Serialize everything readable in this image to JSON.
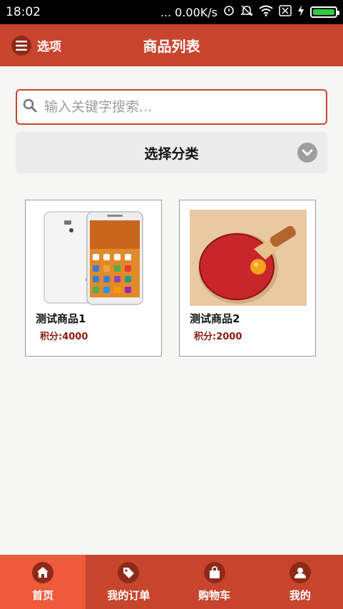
{
  "status_bar": {
    "time": "18:02",
    "network_speed": "... 0.00K/s",
    "battery_color": "#2ecc40"
  },
  "header": {
    "menu_label": "选项",
    "title": "商品列表"
  },
  "search": {
    "placeholder": "输入关键字搜索..."
  },
  "category": {
    "label": "选择分类"
  },
  "products": [
    {
      "name": "测试商品1",
      "points": "积分:4000",
      "image": "phone"
    },
    {
      "name": "测试商品2",
      "points": "积分:2000",
      "image": "ping-pong-paddle"
    }
  ],
  "tabbar": {
    "items": [
      {
        "label": "首页",
        "icon": "home-icon",
        "active": true
      },
      {
        "label": "我的订单",
        "icon": "tag-icon",
        "active": false
      },
      {
        "label": "购物车",
        "icon": "shopping-bag-icon",
        "active": false
      },
      {
        "label": "我的",
        "icon": "user-icon",
        "active": false
      }
    ]
  },
  "colors": {
    "brand": "#c8452d",
    "brand_dark": "#8e2a19",
    "tab_active": "#ef5a3b",
    "points": "#8b1a10"
  }
}
